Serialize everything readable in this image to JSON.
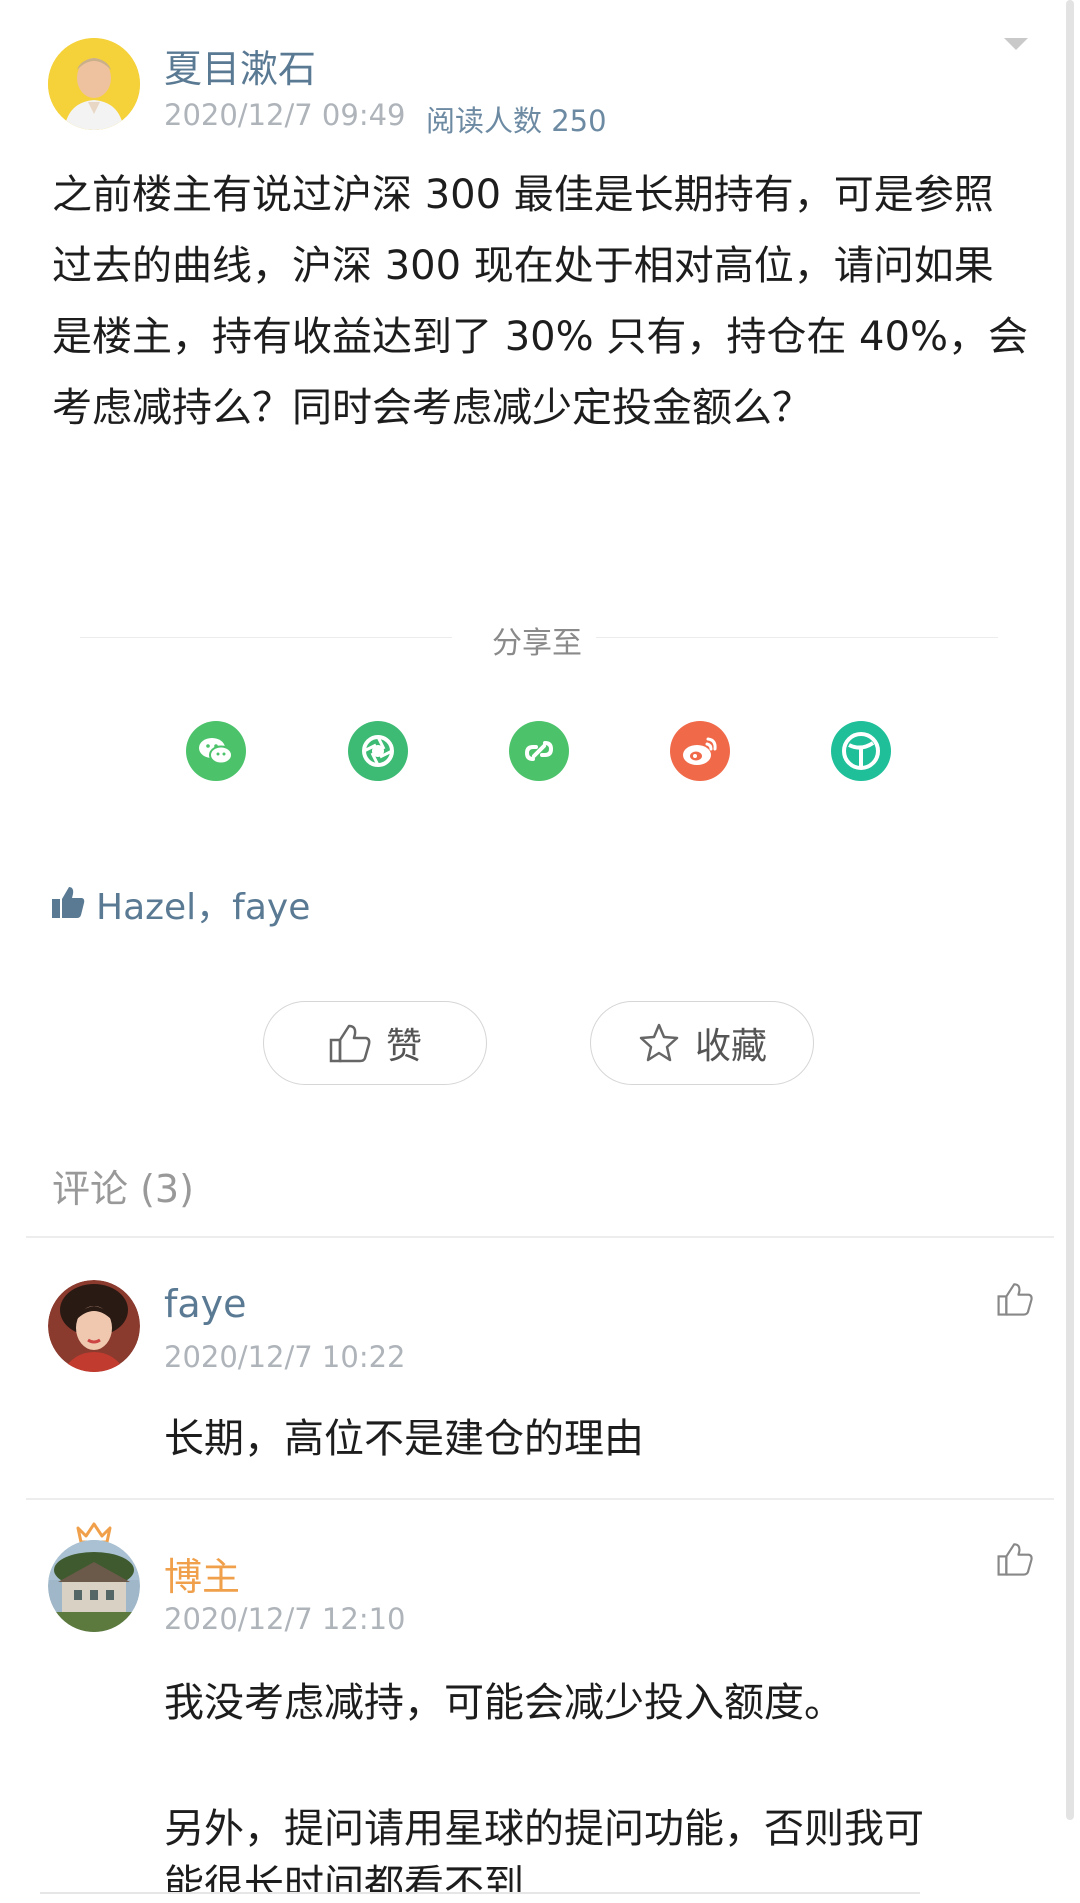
{
  "post": {
    "author": "夏目漱石",
    "date": "2020/12/7 09:49",
    "readers_label": "阅读人数 250",
    "body": "之前楼主有说过沪深 300 最佳是长期持有，可是参照过去的曲线，沪深 300 现在处于相对高位，请问如果是楼主，持有收益达到了 30% 只有，持仓在 40%，会考虑减持么？同时会考虑减少定投金额么？"
  },
  "share": {
    "label": "分享至",
    "icons": [
      {
        "name": "wechat-icon",
        "color": "#4cc36b"
      },
      {
        "name": "moments-icon",
        "color": "#3dbb74"
      },
      {
        "name": "link-icon",
        "color": "#4cc36b"
      },
      {
        "name": "weibo-icon",
        "color": "#f06a4a"
      },
      {
        "name": "app-icon",
        "color": "#1fbf9a"
      }
    ]
  },
  "likes": {
    "users": "Hazel，faye"
  },
  "actions": {
    "like_label": "赞",
    "favorite_label": "收藏"
  },
  "comments": {
    "header": "评论 (3)",
    "items": [
      {
        "author": "faye",
        "date": "2020/12/7 10:22",
        "text": "长期，高位不是建仓的理由"
      },
      {
        "author": "博主",
        "date": "2020/12/7 12:10",
        "text_line1": "我没考虑减持，可能会减少投入额度。",
        "text_line2": "另外，提问请用星球的提问功能，否则我可",
        "text_line3": "能很长时间都看不到"
      }
    ]
  },
  "colors": {
    "link_blue": "#5a7a94",
    "meta_gray": "#aeb4ba",
    "blogger_orange": "#f0a04b"
  }
}
